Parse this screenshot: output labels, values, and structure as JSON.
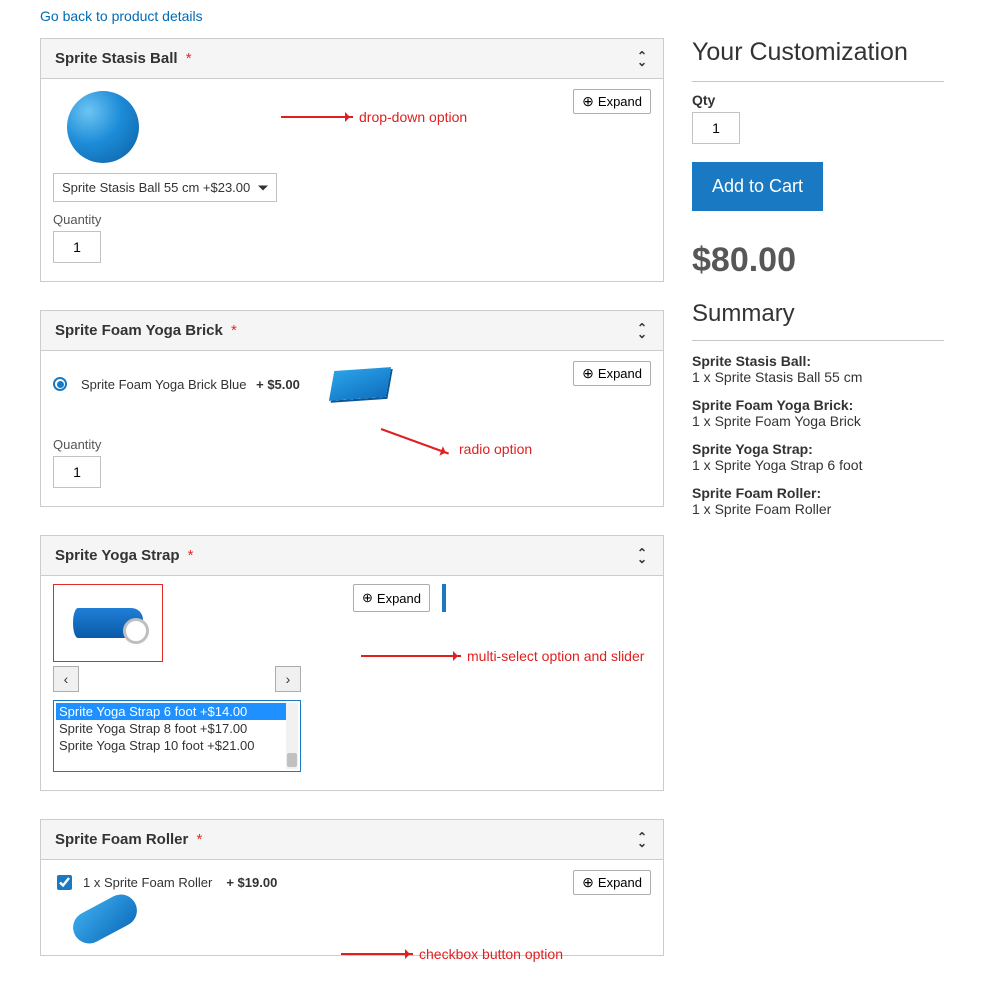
{
  "back_link": "Go back to product details",
  "expand_label": "Expand",
  "quantity_label": "Quantity",
  "sections": {
    "ball": {
      "title": "Sprite Stasis Ball",
      "select_text": "Sprite Stasis Ball 55 cm +$23.00",
      "qty": "1",
      "annot": "drop-down option"
    },
    "brick": {
      "title": "Sprite Foam Yoga Brick",
      "radio_label": "Sprite Foam Yoga Brick Blue",
      "radio_price": "+ $5.00",
      "qty": "1",
      "annot": "radio option"
    },
    "strap": {
      "title": "Sprite Yoga Strap",
      "opts": [
        "Sprite Yoga Strap 6 foot +$14.00",
        "Sprite Yoga Strap 8 foot +$17.00",
        "Sprite Yoga Strap 10 foot +$21.00"
      ],
      "annot": "multi-select option and slider"
    },
    "roller": {
      "title": "Sprite Foam Roller",
      "check_label": "1 x Sprite Foam Roller",
      "check_price": "+ $19.00",
      "annot": "checkbox button option"
    }
  },
  "sidebar": {
    "title": "Your Customization",
    "qty_label": "Qty",
    "qty_value": "1",
    "add_to_cart": "Add to Cart",
    "price": "$80.00",
    "summary_title": "Summary",
    "items": [
      {
        "t": "Sprite Stasis Ball:",
        "v": "1 x Sprite Stasis Ball 55 cm"
      },
      {
        "t": "Sprite Foam Yoga Brick:",
        "v": "1 x Sprite Foam Yoga Brick"
      },
      {
        "t": "Sprite Yoga Strap:",
        "v": "1 x Sprite Yoga Strap 6 foot"
      },
      {
        "t": "Sprite Foam Roller:",
        "v": "1 x Sprite Foam Roller"
      }
    ]
  }
}
